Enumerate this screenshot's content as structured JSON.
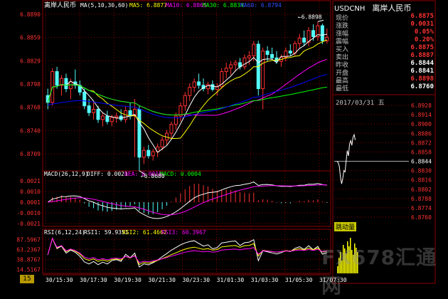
{
  "colors": {
    "up": "#ff3232",
    "down": "#54fcfc",
    "ma5": "#ffffff",
    "ma10": "#ffff00",
    "ma30": "#ff00ff",
    "ma60": "#00ff00",
    "ma_extra": "#0000ff",
    "grid": "#8b0000",
    "axis_text": "#c0c0c0",
    "red_text": "#ff3232",
    "white_text": "#ffffff"
  },
  "header": {
    "title": "离岸人民币",
    "ma_label": "MA(5,10,30,60)",
    "ma5": "MA5: 6.8877",
    "ma10": "MA10: 6.8865",
    "ma30": "MA30: 6.8834",
    "ma60": "MA60: 6.8794"
  },
  "macd_header": {
    "params": "MACD(26,12,9)",
    "diff": "DIFF: 0.0021",
    "dea": "DEA: 0.0018",
    "macd": "MACD: 0.0004"
  },
  "rsi_header": {
    "params": "RSI(6,12,24)",
    "rsi1": "RSI1: 59.9351",
    "rsi2": "RSI2: 61.4662",
    "rsi3": "RSI3: 60.3967"
  },
  "interval": "15分",
  "quote": {
    "symbol": "USDCNH",
    "name": "离岸人民币",
    "rows": [
      {
        "label": "现价",
        "value": "6.8875",
        "color": "#ff3232"
      },
      {
        "label": "涨跌",
        "value": "0.0031",
        "color": "#ff3232"
      },
      {
        "label": "涨幅",
        "value": "0.05%",
        "color": "#ff3232"
      },
      {
        "label": "震幅",
        "value": "0.20%",
        "color": "#ff3232"
      },
      {
        "label": "买入",
        "value": "6.8875",
        "color": "#ff3232"
      },
      {
        "label": "卖出",
        "value": "6.8887",
        "color": "#ff3232"
      },
      {
        "label": "昨收",
        "value": "6.8844",
        "color": "#ffffff"
      },
      {
        "label": "开盘",
        "value": "6.8841",
        "color": "#ffffff"
      },
      {
        "label": "最高",
        "value": "6.8898",
        "color": "#ff3232"
      },
      {
        "label": "最低",
        "value": "6.8760",
        "color": "#ffffff"
      }
    ]
  },
  "tick_panel": {
    "date_label": "2017/03/31 五",
    "price_ticks": [
      "6.8928",
      "6.8914",
      "6.8900",
      "6.8886",
      "6.8872",
      "6.8858",
      "6.8844",
      "6.8830",
      "6.8816",
      "6.8802",
      "6.8788",
      "6.8774",
      "6.8760"
    ],
    "ref_price": 6.8844,
    "vol_label": "跳动量"
  },
  "watermark": "FX678汇通网",
  "chart_data": [
    {
      "type": "candlestick",
      "title": "离岸人民币",
      "ylim": [
        6.868,
        6.8915
      ],
      "y_ticks": [
        "6.8890",
        "6.8859",
        "6.8829",
        "6.8798",
        "6.8768",
        "6.8740",
        "6.8709"
      ],
      "x_ticks": [
        "30/15:30",
        "30/17:30",
        "30/19:30",
        "30/21:30",
        "30/23:30",
        "31/01:30",
        "31/03:30",
        "31/05:30",
        "31/07:30"
      ],
      "annotations": [
        {
          "text": "6.8898",
          "value": 6.8898,
          "bar": 59
        },
        {
          "text": "6.8680",
          "value": 6.868,
          "bar": 20
        }
      ],
      "series_names": [
        "MA5",
        "MA10",
        "MA30",
        "MA60"
      ],
      "candles": [
        {
          "o": 6.879,
          "h": 6.88,
          "l": 6.877,
          "c": 6.878
        },
        {
          "o": 6.878,
          "h": 6.883,
          "l": 6.8775,
          "c": 6.8825
        },
        {
          "o": 6.8825,
          "h": 6.8832,
          "l": 6.88,
          "c": 6.8805
        },
        {
          "o": 6.8805,
          "h": 6.882,
          "l": 6.879,
          "c": 6.8815
        },
        {
          "o": 6.8815,
          "h": 6.8822,
          "l": 6.8795,
          "c": 6.88
        },
        {
          "o": 6.88,
          "h": 6.8815,
          "l": 6.8785,
          "c": 6.881
        },
        {
          "o": 6.881,
          "h": 6.8828,
          "l": 6.88,
          "c": 6.8805
        },
        {
          "o": 6.8805,
          "h": 6.8812,
          "l": 6.879,
          "c": 6.8795
        },
        {
          "o": 6.8795,
          "h": 6.88,
          "l": 6.877,
          "c": 6.8775
        },
        {
          "o": 6.8775,
          "h": 6.8785,
          "l": 6.876,
          "c": 6.8765
        },
        {
          "o": 6.8765,
          "h": 6.878,
          "l": 6.8755,
          "c": 6.877
        },
        {
          "o": 6.877,
          "h": 6.8775,
          "l": 6.875,
          "c": 6.8755
        },
        {
          "o": 6.8755,
          "h": 6.8765,
          "l": 6.8745,
          "c": 6.876
        },
        {
          "o": 6.876,
          "h": 6.8768,
          "l": 6.8748,
          "c": 6.8752
        },
        {
          "o": 6.8752,
          "h": 6.8762,
          "l": 6.8745,
          "c": 6.8758
        },
        {
          "o": 6.8758,
          "h": 6.8765,
          "l": 6.875,
          "c": 6.876
        },
        {
          "o": 6.876,
          "h": 6.877,
          "l": 6.8752,
          "c": 6.8755
        },
        {
          "o": 6.8755,
          "h": 6.8775,
          "l": 6.875,
          "c": 6.8768
        },
        {
          "o": 6.8768,
          "h": 6.878,
          "l": 6.8755,
          "c": 6.876
        },
        {
          "o": 6.876,
          "h": 6.8785,
          "l": 6.87,
          "c": 6.877
        },
        {
          "o": 6.877,
          "h": 6.8775,
          "l": 6.868,
          "c": 6.87
        },
        {
          "o": 6.87,
          "h": 6.8715,
          "l": 6.869,
          "c": 6.871
        },
        {
          "o": 6.871,
          "h": 6.8718,
          "l": 6.8698,
          "c": 6.8702
        },
        {
          "o": 6.8702,
          "h": 6.8712,
          "l": 6.8695,
          "c": 6.8708
        },
        {
          "o": 6.8708,
          "h": 6.872,
          "l": 6.87,
          "c": 6.8715
        },
        {
          "o": 6.8715,
          "h": 6.873,
          "l": 6.871,
          "c": 6.8725
        },
        {
          "o": 6.8725,
          "h": 6.874,
          "l": 6.8718,
          "c": 6.8735
        },
        {
          "o": 6.8735,
          "h": 6.8752,
          "l": 6.8728,
          "c": 6.8748
        },
        {
          "o": 6.8748,
          "h": 6.8765,
          "l": 6.874,
          "c": 6.876
        },
        {
          "o": 6.876,
          "h": 6.878,
          "l": 6.8752,
          "c": 6.8775
        },
        {
          "o": 6.8775,
          "h": 6.8795,
          "l": 6.8768,
          "c": 6.879
        },
        {
          "o": 6.879,
          "h": 6.8808,
          "l": 6.8782,
          "c": 6.8802
        },
        {
          "o": 6.8802,
          "h": 6.8815,
          "l": 6.8795,
          "c": 6.881
        },
        {
          "o": 6.881,
          "h": 6.8822,
          "l": 6.88,
          "c": 6.8805
        },
        {
          "o": 6.8805,
          "h": 6.8815,
          "l": 6.8796,
          "c": 6.88
        },
        {
          "o": 6.88,
          "h": 6.881,
          "l": 6.8792,
          "c": 6.8806
        },
        {
          "o": 6.8806,
          "h": 6.8812,
          "l": 6.8796,
          "c": 6.8799
        },
        {
          "o": 6.8799,
          "h": 6.8808,
          "l": 6.879,
          "c": 6.8803
        },
        {
          "o": 6.8803,
          "h": 6.883,
          "l": 6.88,
          "c": 6.8825
        },
        {
          "o": 6.8825,
          "h": 6.8838,
          "l": 6.8815,
          "c": 6.883
        },
        {
          "o": 6.883,
          "h": 6.884,
          "l": 6.882,
          "c": 6.8835
        },
        {
          "o": 6.8835,
          "h": 6.8842,
          "l": 6.8825,
          "c": 6.8838
        },
        {
          "o": 6.8838,
          "h": 6.8845,
          "l": 6.8828,
          "c": 6.8832
        },
        {
          "o": 6.8832,
          "h": 6.885,
          "l": 6.8828,
          "c": 6.8845
        },
        {
          "o": 6.8845,
          "h": 6.8855,
          "l": 6.8835,
          "c": 6.8848
        },
        {
          "o": 6.8848,
          "h": 6.887,
          "l": 6.884,
          "c": 6.8865
        },
        {
          "o": 6.8865,
          "h": 6.887,
          "l": 6.879,
          "c": 6.88
        },
        {
          "o": 6.88,
          "h": 6.886,
          "l": 6.877,
          "c": 6.8855
        },
        {
          "o": 6.8855,
          "h": 6.8862,
          "l": 6.884,
          "c": 6.885
        },
        {
          "o": 6.885,
          "h": 6.886,
          "l": 6.8842,
          "c": 6.8845
        },
        {
          "o": 6.8845,
          "h": 6.8855,
          "l": 6.8836,
          "c": 6.884
        },
        {
          "o": 6.884,
          "h": 6.885,
          "l": 6.8832,
          "c": 6.8846
        },
        {
          "o": 6.8846,
          "h": 6.886,
          "l": 6.884,
          "c": 6.8855
        },
        {
          "o": 6.8855,
          "h": 6.8865,
          "l": 6.8848,
          "c": 6.8852
        },
        {
          "o": 6.8852,
          "h": 6.887,
          "l": 6.8848,
          "c": 6.8866
        },
        {
          "o": 6.8866,
          "h": 6.888,
          "l": 6.8858,
          "c": 6.8874
        },
        {
          "o": 6.8874,
          "h": 6.8885,
          "l": 6.8862,
          "c": 6.8868
        },
        {
          "o": 6.8868,
          "h": 6.889,
          "l": 6.8862,
          "c": 6.8885
        },
        {
          "o": 6.8885,
          "h": 6.8894,
          "l": 6.887,
          "c": 6.8876
        },
        {
          "o": 6.8876,
          "h": 6.8898,
          "l": 6.887,
          "c": 6.8892
        },
        {
          "o": 6.8892,
          "h": 6.8895,
          "l": 6.8865,
          "c": 6.887
        },
        {
          "o": 6.887,
          "h": 6.8888,
          "l": 6.8866,
          "c": 6.8875
        }
      ]
    },
    {
      "type": "macd",
      "title": "MACD(26,12,9)",
      "y_ticks": [
        "0.0021",
        "0.0010",
        "0.0001",
        "-0.0010",
        "-0.0021"
      ],
      "ylim": [
        -0.0028,
        0.0028
      ],
      "series_names": [
        "DIFF",
        "DEA",
        "MACD"
      ]
    },
    {
      "type": "rsi",
      "title": "RSI(6,12,24)",
      "y_ticks": [
        "87.5967",
        "63.2367",
        "38.8767",
        "14.5167"
      ],
      "ylim": [
        5,
        95
      ],
      "series_names": [
        "RSI1",
        "RSI2",
        "RSI3"
      ]
    }
  ]
}
